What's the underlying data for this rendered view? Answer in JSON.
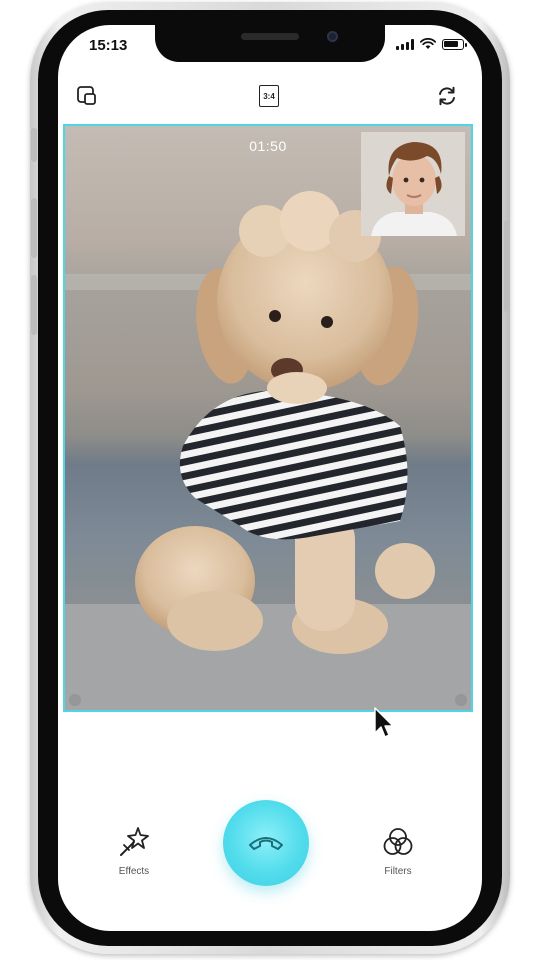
{
  "status_bar": {
    "time": "15:13",
    "battery_level": 0.8
  },
  "toolbar": {
    "left_icon": "picture-in-picture-icon",
    "ratio_label": "3:4",
    "right_icon": "switch-camera-icon"
  },
  "call": {
    "duration": "01:50"
  },
  "controls": {
    "effects_label": "Effects",
    "filters_label": "Filters",
    "end_call_icon": "hang-up-icon"
  },
  "colors": {
    "accent": "#4fd6e6",
    "end_call": "#52dcec"
  }
}
